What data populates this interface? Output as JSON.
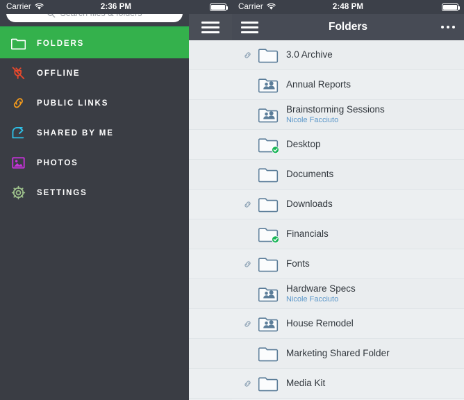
{
  "left_phone": {
    "status": {
      "carrier": "Carrier",
      "time": "2:36 PM",
      "wifi_icon": "wifi-icon",
      "battery_icon": "battery-icon"
    },
    "search": {
      "placeholder": "Search files & folders",
      "value": "",
      "icon": "search-icon"
    },
    "menu_icon": "hamburger-menu-icon",
    "menu": {
      "items": [
        {
          "label": "FOLDERS",
          "icon": "folder-icon",
          "color": "#ffffff",
          "active": true
        },
        {
          "label": "OFFLINE",
          "icon": "plug-disconnect-icon",
          "color": "#e8482c",
          "active": false
        },
        {
          "label": "PUBLIC LINKS",
          "icon": "chain-link-icon",
          "color": "#f29a1d",
          "active": false
        },
        {
          "label": "SHARED BY ME",
          "icon": "share-arrow-icon",
          "color": "#2ec1e8",
          "active": false
        },
        {
          "label": "PHOTOS",
          "icon": "photo-image-icon",
          "color": "#c932dd",
          "active": false
        },
        {
          "label": "SETTINGS",
          "icon": "gear-icon",
          "color": "#9dc08b",
          "active": false
        }
      ],
      "active_color": "#34b14c"
    },
    "list": [
      {
        "name": "3.0 Archive",
        "sub": "",
        "icon": "folder-icon",
        "link": true,
        "check": false
      },
      {
        "name": "Annual Reports",
        "sub": "",
        "icon": "shared-folder-icon",
        "link": false,
        "check": false
      },
      {
        "name": "Brainstorming Sessions",
        "sub": "",
        "icon": "shared-folder-icon",
        "link": false,
        "check": false
      },
      {
        "name": "Desktop",
        "sub": "",
        "icon": "folder-icon",
        "link": false,
        "check": true
      },
      {
        "name": "Documents",
        "sub": "",
        "icon": "folder-icon",
        "link": false,
        "check": false
      },
      {
        "name": "Downloads",
        "sub": "",
        "icon": "folder-icon",
        "link": true,
        "check": false
      },
      {
        "name": "Financials",
        "sub": "",
        "icon": "folder-icon",
        "link": false,
        "check": true
      },
      {
        "name": "Fonts",
        "sub": "",
        "icon": "folder-icon",
        "link": true,
        "check": false
      },
      {
        "name": "Hardware Specs",
        "sub": "",
        "icon": "shared-folder-icon",
        "link": false,
        "check": false
      },
      {
        "name": "House Remodel",
        "sub": "",
        "icon": "shared-folder-icon",
        "link": true,
        "check": false
      },
      {
        "name": "Marketing Shared Folder",
        "sub": "",
        "icon": "folder-icon",
        "link": false,
        "check": false
      },
      {
        "name": "Media Kit",
        "sub": "",
        "icon": "folder-icon",
        "link": true,
        "check": false
      }
    ]
  },
  "right_phone": {
    "status": {
      "carrier": "Carrier",
      "time": "2:48 PM",
      "wifi_icon": "wifi-icon",
      "battery_icon": "battery-icon"
    },
    "navbar": {
      "title": "Folders",
      "menu_icon": "hamburger-menu-icon",
      "more_icon": "ellipsis-icon"
    },
    "list": [
      {
        "name": "3.0 Archive",
        "sub": "",
        "icon": "folder-icon",
        "link": true,
        "check": false
      },
      {
        "name": "Annual Reports",
        "sub": "",
        "icon": "shared-folder-icon",
        "link": false,
        "check": false
      },
      {
        "name": "Brainstorming Sessions",
        "sub": "Nicole Facciuto",
        "icon": "shared-folder-icon",
        "link": false,
        "check": false
      },
      {
        "name": "Desktop",
        "sub": "",
        "icon": "folder-icon",
        "link": false,
        "check": true
      },
      {
        "name": "Documents",
        "sub": "",
        "icon": "folder-icon",
        "link": false,
        "check": false
      },
      {
        "name": "Downloads",
        "sub": "",
        "icon": "folder-icon",
        "link": true,
        "check": false
      },
      {
        "name": "Financials",
        "sub": "",
        "icon": "folder-icon",
        "link": false,
        "check": true
      },
      {
        "name": "Fonts",
        "sub": "",
        "icon": "folder-icon",
        "link": true,
        "check": false
      },
      {
        "name": "Hardware Specs",
        "sub": "Nicole Facciuto",
        "icon": "shared-folder-icon",
        "link": false,
        "check": false
      },
      {
        "name": "House Remodel",
        "sub": "",
        "icon": "shared-folder-icon",
        "link": true,
        "check": false
      },
      {
        "name": "Marketing Shared Folder",
        "sub": "",
        "icon": "folder-icon",
        "link": false,
        "check": false
      },
      {
        "name": "Media Kit",
        "sub": "",
        "icon": "folder-icon",
        "link": true,
        "check": false
      }
    ]
  },
  "colors": {
    "accent_green": "#34b14c",
    "folder_outline": "#5b7d99",
    "check_green": "#19b558",
    "sub_blue": "#5b97c9",
    "statusbar": "#3c4049",
    "navbar": "#474b55",
    "drawer": "#3a3d44"
  }
}
